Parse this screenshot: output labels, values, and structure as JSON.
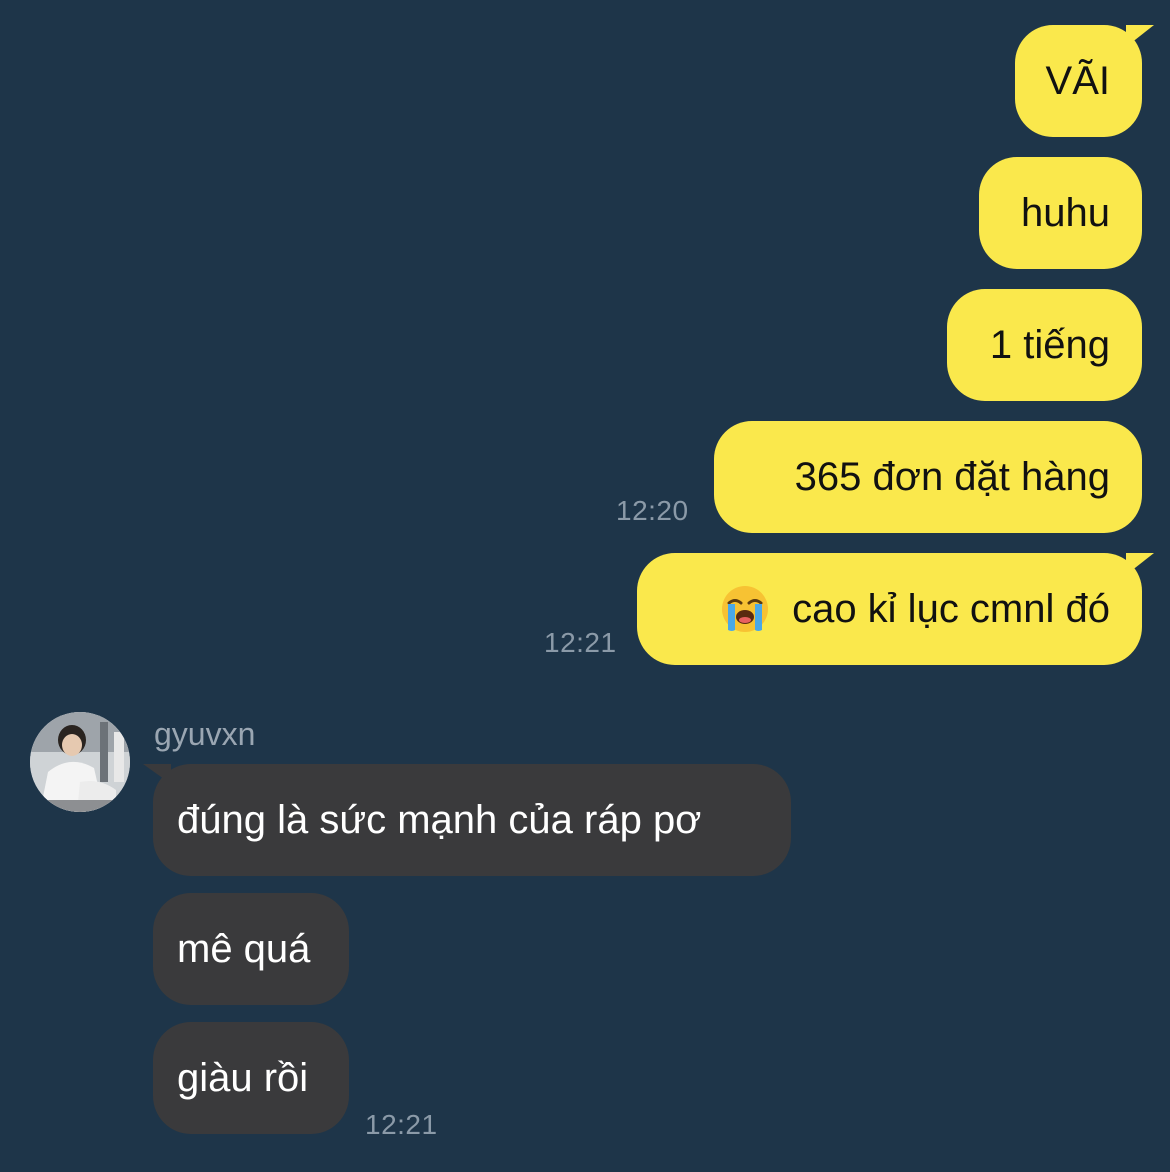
{
  "outgoing": [
    {
      "text": "VÃI"
    },
    {
      "text": "huhu"
    },
    {
      "text": "1 tiếng"
    },
    {
      "text": "365 đơn đặt hàng",
      "time": "12:20"
    },
    {
      "text": "cao kỉ lục cmnl đó",
      "emoji": "loudly-crying-face-icon",
      "time": "12:21"
    }
  ],
  "incoming": {
    "sender": "gyuvxn",
    "messages": [
      {
        "text": "đúng là sức mạnh của ráp pơ"
      },
      {
        "text": "mê quá"
      },
      {
        "text": "giàu rồi",
        "time": "12:21"
      }
    ]
  },
  "colors": {
    "background": "#1e3549",
    "outgoing_bubble": "#fae84c",
    "incoming_bubble": "#3a3a3c",
    "timestamp": "#8b9aa8"
  }
}
